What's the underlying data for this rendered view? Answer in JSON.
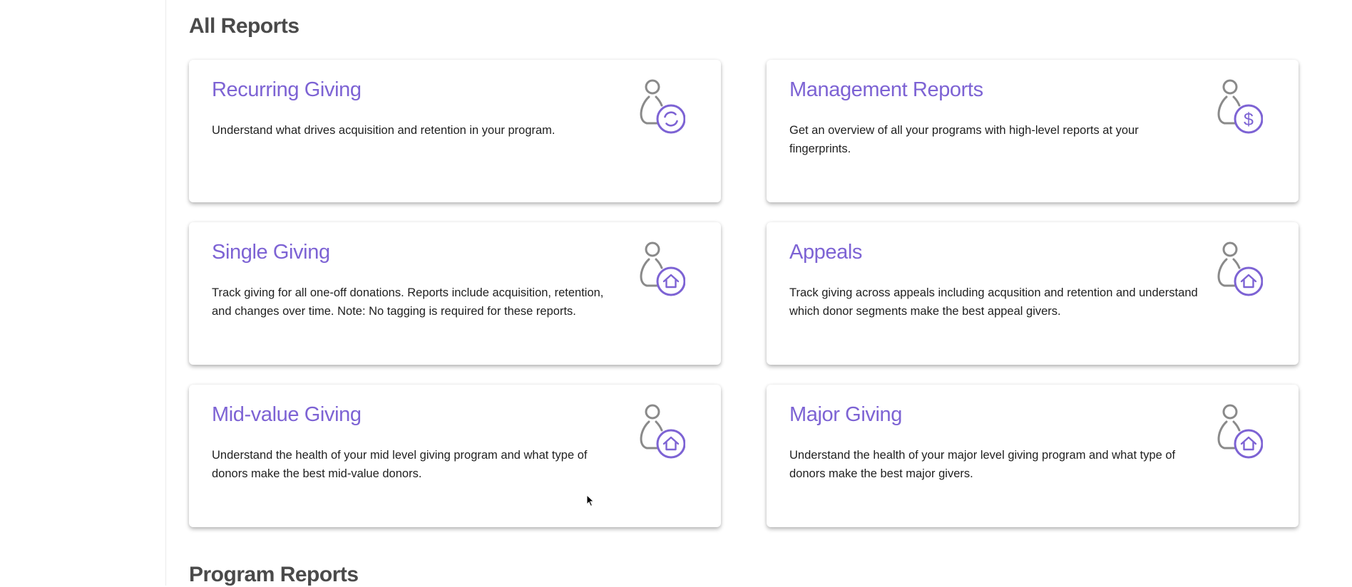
{
  "all_reports": {
    "title": "All Reports",
    "cards": [
      {
        "title": "Recurring Giving",
        "description": "Understand what drives acquisition and retention in your program.",
        "icon": "user-recurring-icon"
      },
      {
        "title": "Management Reports",
        "description": "Get an overview of all your programs with high-level reports at your fingerprints.",
        "icon": "user-dollar-icon"
      },
      {
        "title": "Single Giving",
        "description": "Track giving for all one-off donations. Reports include acquisition, retention, and changes over time. Note: No tagging is required for these reports.",
        "icon": "user-home-icon"
      },
      {
        "title": "Appeals",
        "description": "Track giving across appeals including acqusition and retention and understand which donor segments make the best appeal givers.",
        "icon": "user-home-icon"
      },
      {
        "title": "Mid-value Giving",
        "description": "Understand the health of your mid level giving program and what type of donors make the best mid-value donors.",
        "icon": "user-home-icon"
      },
      {
        "title": "Major Giving",
        "description": "Understand the health of your major level giving program and what type of donors make the best major givers.",
        "icon": "user-home-icon"
      }
    ]
  },
  "program_reports": {
    "title": "Program Reports"
  },
  "colors": {
    "accent": "#7d63d4",
    "icon_gray": "#8a8a8a",
    "heading": "#4a4a4a",
    "body_text": "#1f1f1f"
  }
}
